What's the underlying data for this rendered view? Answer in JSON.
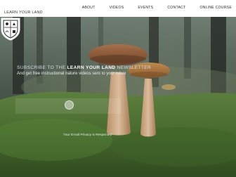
{
  "header": {
    "brand": "LEARN YOUR LAND",
    "nav": [
      {
        "label": "ABOUT"
      },
      {
        "label": "VIDEOS"
      },
      {
        "label": "EVENTS"
      },
      {
        "label": "CONTACT"
      },
      {
        "label": "ONLINE COURSE"
      }
    ]
  },
  "hero": {
    "subscribe_prefix": "SUBSCRIBE TO THE ",
    "subscribe_brand": "LEARN YOUR LAND",
    "subscribe_suffix": " NEWSLETTER",
    "tagline": "And get free instructional nature videos sent to your inbox",
    "email_placeholder": "",
    "privacy_note": "Your Email Privacy is Respected"
  },
  "colors": {
    "moss": "#4f7a36",
    "forest": "#2c3a2e",
    "mushroom_cap": "#8a5a3a",
    "mushroom_stem": "#d3b08e"
  },
  "icons": {
    "crest": "shield-crest-icon",
    "submit": "circle-submit-icon"
  }
}
